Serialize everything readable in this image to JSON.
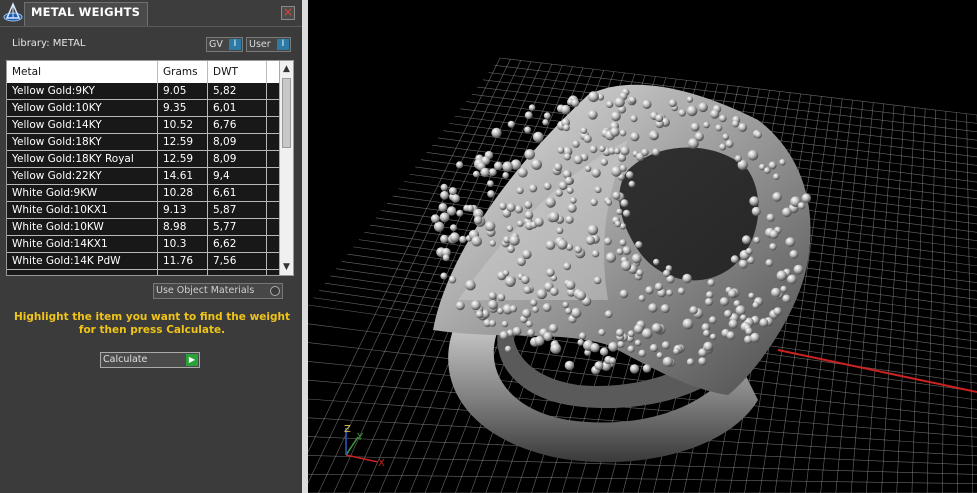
{
  "panel": {
    "title": "METAL WEIGHTS",
    "close_glyph": "×",
    "library_label": "Library: METAL",
    "toggles": [
      {
        "label": "GV",
        "knob": "I"
      },
      {
        "label": "User",
        "knob": "I"
      }
    ],
    "table": {
      "columns": [
        "Metal",
        "Grams",
        "DWT"
      ],
      "rows": [
        {
          "metal": "Yellow Gold:9KY",
          "grams": "9.05",
          "dwt": "5,82"
        },
        {
          "metal": "Yellow Gold:10KY",
          "grams": "9.35",
          "dwt": "6,01"
        },
        {
          "metal": "Yellow Gold:14KY",
          "grams": "10.52",
          "dwt": "6,76"
        },
        {
          "metal": "Yellow Gold:18KY",
          "grams": "12.59",
          "dwt": "8,09"
        },
        {
          "metal": "Yellow Gold:18KY Royal",
          "grams": "12.59",
          "dwt": "8,09"
        },
        {
          "metal": "Yellow Gold:22KY",
          "grams": "14.61",
          "dwt": "9,4"
        },
        {
          "metal": "White Gold:9KW",
          "grams": "10.28",
          "dwt": "6,61"
        },
        {
          "metal": "White Gold:10KX1",
          "grams": "9.13",
          "dwt": "5,87"
        },
        {
          "metal": "White Gold:10KW",
          "grams": "8.98",
          "dwt": "5,77"
        },
        {
          "metal": "White Gold:14KX1",
          "grams": "10.3",
          "dwt": "6,62"
        },
        {
          "metal": "White Gold:14K PdW",
          "grams": "11.76",
          "dwt": "7,56"
        }
      ]
    },
    "use_object_materials": "Use Object Materials",
    "hint_line1": "Highlight the item you want to find the weight",
    "hint_line2": "for then press Calculate.",
    "calculate_label": "Calculate",
    "colors": {
      "hint": "#f0c419",
      "accent": "#2d7aa6",
      "go": "#2aa23a"
    }
  },
  "viewport": {
    "axis_labels": {
      "x": "X",
      "y": "Y",
      "z": "Z"
    },
    "colors": {
      "grid": "#8a8a8a",
      "x_axis": "#cc2222",
      "background": "#000000"
    }
  }
}
